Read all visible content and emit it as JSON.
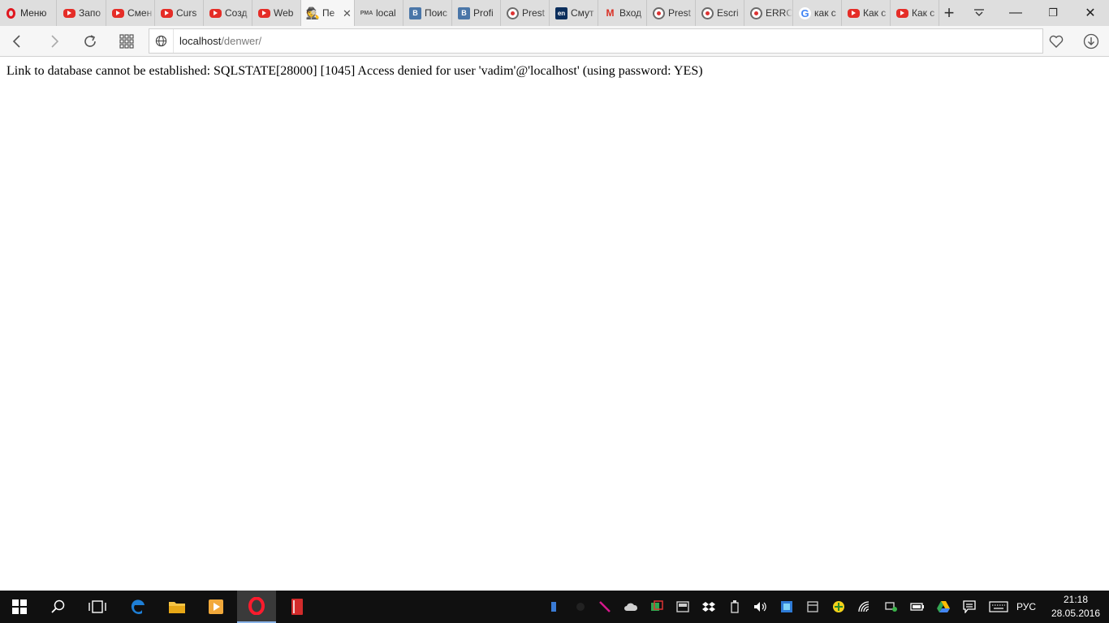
{
  "browser": {
    "menu_label": "Меню",
    "tabs": [
      {
        "icon": "youtube-icon",
        "title": "Запо",
        "active": false
      },
      {
        "icon": "youtube-icon",
        "title": "Смен",
        "active": false
      },
      {
        "icon": "youtube-icon",
        "title": "Curs",
        "active": false
      },
      {
        "icon": "youtube-icon",
        "title": "Созд",
        "active": false
      },
      {
        "icon": "youtube-icon",
        "title": "Web",
        "active": false
      },
      {
        "icon": "spy-icon",
        "title": "Пе",
        "active": true
      },
      {
        "icon": "phpmyadmin-icon",
        "title": "local",
        "active": false
      },
      {
        "icon": "vk-icon",
        "title": "Поис",
        "active": false
      },
      {
        "icon": "vk-icon",
        "title": "Profi",
        "active": false
      },
      {
        "icon": "prestashop-icon",
        "title": "Prest",
        "active": false
      },
      {
        "icon": "en-icon",
        "title": "Смут",
        "active": false
      },
      {
        "icon": "gmail-icon",
        "title": "Вход",
        "active": false
      },
      {
        "icon": "prestashop-icon",
        "title": "Prest",
        "active": false
      },
      {
        "icon": "prestashop-icon",
        "title": "Escri",
        "active": false
      },
      {
        "icon": "prestashop-icon",
        "title": "ERRO",
        "active": false
      },
      {
        "icon": "google-icon",
        "title": "как с",
        "active": false
      },
      {
        "icon": "youtube-icon",
        "title": "Как с",
        "active": false
      },
      {
        "icon": "youtube-icon",
        "title": "Как с",
        "active": false
      }
    ],
    "favicon_text": {
      "vk": "В",
      "en": "en",
      "gmail": "M",
      "google": "G",
      "pma": "PMA",
      "spy": "🕵"
    },
    "new_tab_glyph": "+",
    "window": {
      "minimize": "—",
      "maximize": "❐",
      "close": "✕"
    },
    "address": {
      "host": "localhost",
      "path": "/denwer/"
    }
  },
  "page": {
    "error_message": "Link to database cannot be established: SQLSTATE[28000] [1045] Access denied for user 'vadim'@'localhost' (using password: YES)"
  },
  "taskbar": {
    "language": "РУС",
    "time": "21:18",
    "date": "28.05.2016"
  },
  "colors": {
    "opera_red": "#e0171f",
    "youtube_red": "#e52d27",
    "vk_blue": "#4a76a8",
    "taskbar_bg": "#101010"
  }
}
